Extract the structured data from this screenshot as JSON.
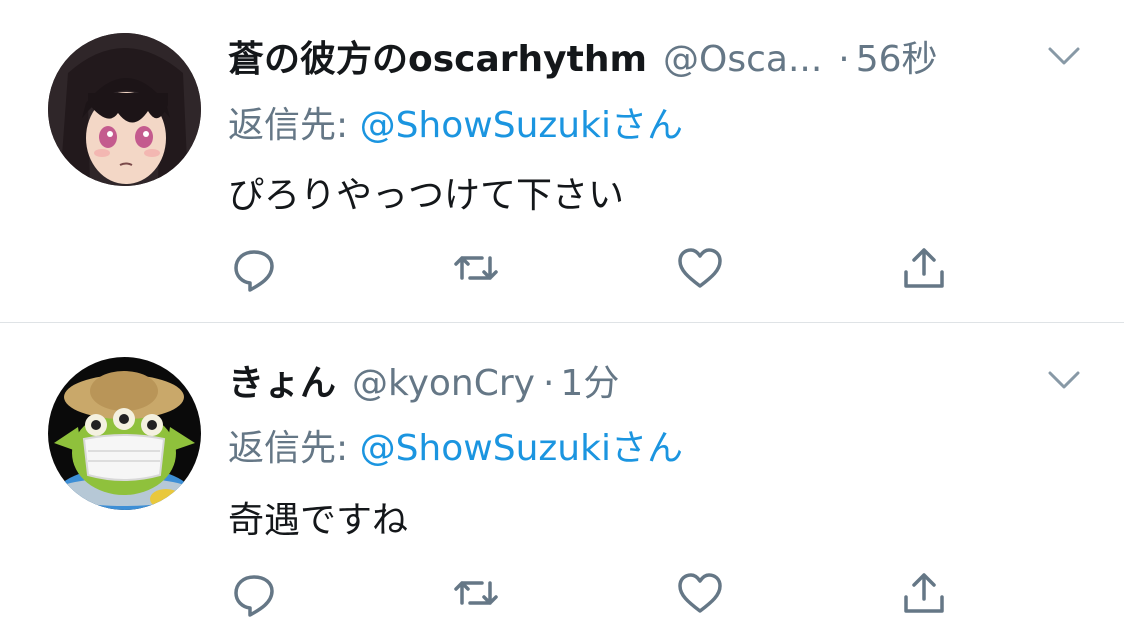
{
  "colors": {
    "text_primary": "#14171a",
    "text_secondary": "#657786",
    "mention_blue": "#1b95e0",
    "divider": "#dfe3e6"
  },
  "tweets": [
    {
      "display_name": "蒼の彼方のoscarhythm",
      "handle": "@Osca...",
      "separator": "·",
      "time": "56秒",
      "reply_prefix": "返信先: ",
      "reply_mention": "@ShowSuzukiさん",
      "text": "ぴろりやっつけて下さい",
      "avatar_icon": "anime-girl-avatar",
      "actions": [
        "reply-icon",
        "retweet-icon",
        "like-icon",
        "share-icon"
      ]
    },
    {
      "display_name": "きょん",
      "handle": "@kyonCry",
      "separator": "·",
      "time": "1分",
      "reply_prefix": "返信先: ",
      "reply_mention": "@ShowSuzukiさん",
      "text": "奇遇ですね",
      "avatar_icon": "green-alien-avatar",
      "actions": [
        "reply-icon",
        "retweet-icon",
        "like-icon",
        "share-icon"
      ]
    }
  ]
}
